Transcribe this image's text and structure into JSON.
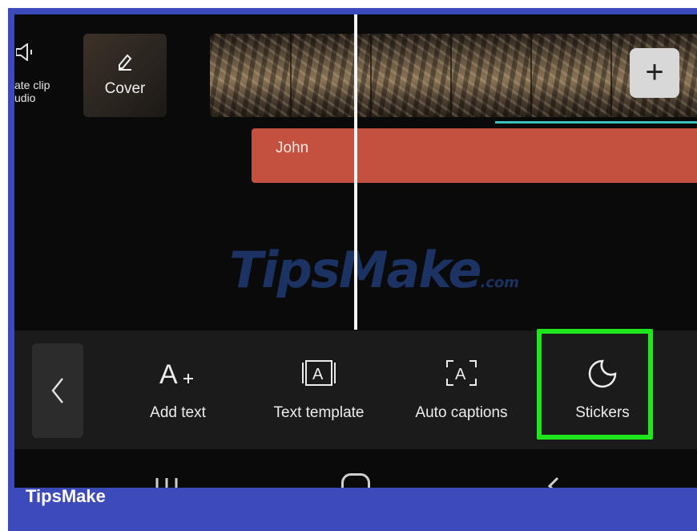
{
  "timeline": {
    "mute_label": "ate clip\nudio",
    "cover_label": "Cover",
    "text_clip_label": "John",
    "add_clip_label": "+"
  },
  "watermark": {
    "main": "TipsMake",
    "suffix": ".com"
  },
  "toolbar": {
    "back_label": "<",
    "tools": [
      {
        "label": "Add text",
        "icon": "add-text-icon"
      },
      {
        "label": "Text template",
        "icon": "text-template-icon"
      },
      {
        "label": "Auto captions",
        "icon": "auto-captions-icon"
      },
      {
        "label": "Stickers",
        "icon": "stickers-icon"
      }
    ]
  },
  "brand": {
    "name": "TipsMake"
  },
  "colors": {
    "frame": "#3d4ab9",
    "text_clip": "#c4503f",
    "highlight": "#1ee81b",
    "accent_line": "#3cc1b8"
  }
}
